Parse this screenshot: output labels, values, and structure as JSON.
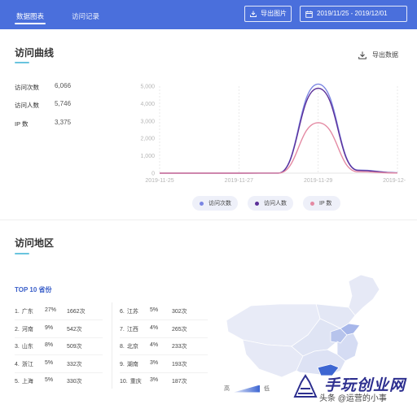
{
  "header": {
    "tabs": [
      {
        "label": "数据图表",
        "active": true
      },
      {
        "label": "访问记录",
        "active": false
      }
    ],
    "export_image_label": "导出图片",
    "date_range": "2019/11/25 - 2019/12/01",
    "background_color": "#4a6fdc"
  },
  "visit_curve": {
    "title": "访问曲线",
    "export_label": "导出数据",
    "stats": [
      {
        "label": "访问次数",
        "value": "6,066"
      },
      {
        "label": "访问人数",
        "value": "5,746"
      },
      {
        "label": "IP 数",
        "value": "3,375"
      }
    ],
    "legend": [
      {
        "label": "访问次数",
        "color": "#7b86e3"
      },
      {
        "label": "访问人数",
        "color": "#5b2f99"
      },
      {
        "label": "IP 数",
        "color": "#e48aa3"
      }
    ]
  },
  "chart_data": {
    "type": "line",
    "x": [
      "2019-11-25",
      "2019-11-26",
      "2019-11-27",
      "2019-11-28",
      "2019-11-29",
      "2019-11-30",
      "2019-12-01"
    ],
    "xticks": [
      "2019-11-25",
      "2019-11-27",
      "2019-11-29",
      "2019-12-01"
    ],
    "yticks": [
      "0",
      "1,000",
      "2,000",
      "3,000",
      "4,000",
      "5,000"
    ],
    "ylim": [
      0,
      5000
    ],
    "series": [
      {
        "name": "访问次数",
        "color": "#7b86e3",
        "values": [
          0,
          0,
          0,
          5,
          5120,
          180,
          20
        ]
      },
      {
        "name": "访问人数",
        "color": "#5b2f99",
        "values": [
          0,
          0,
          0,
          5,
          4880,
          160,
          15
        ]
      },
      {
        "name": "IP 数",
        "color": "#e48aa3",
        "values": [
          0,
          0,
          0,
          3,
          2900,
          80,
          10
        ]
      }
    ],
    "grid": true,
    "legend": "bottom"
  },
  "region": {
    "title": "访问地区",
    "top10_title": "TOP 10 省份",
    "provinces": [
      {
        "rank": "1.",
        "name": "广东",
        "pct": "27%",
        "count": "1662次"
      },
      {
        "rank": "2.",
        "name": "河南",
        "pct": "9%",
        "count": "542次"
      },
      {
        "rank": "3.",
        "name": "山东",
        "pct": "8%",
        "count": "509次"
      },
      {
        "rank": "4.",
        "name": "浙江",
        "pct": "5%",
        "count": "332次"
      },
      {
        "rank": "5.",
        "name": "上海",
        "pct": "5%",
        "count": "330次"
      },
      {
        "rank": "6.",
        "name": "江苏",
        "pct": "5%",
        "count": "302次"
      },
      {
        "rank": "7.",
        "name": "江西",
        "pct": "4%",
        "count": "265次"
      },
      {
        "rank": "8.",
        "name": "北京",
        "pct": "4%",
        "count": "233次"
      },
      {
        "rank": "9.",
        "name": "湖南",
        "pct": "3%",
        "count": "193次"
      },
      {
        "rank": "10.",
        "name": "重庆",
        "pct": "3%",
        "count": "187次"
      }
    ],
    "scale_high": "高",
    "scale_low": "低"
  },
  "watermark": {
    "brand": "手玩创业网",
    "caption": "头条 @运营的小事"
  }
}
